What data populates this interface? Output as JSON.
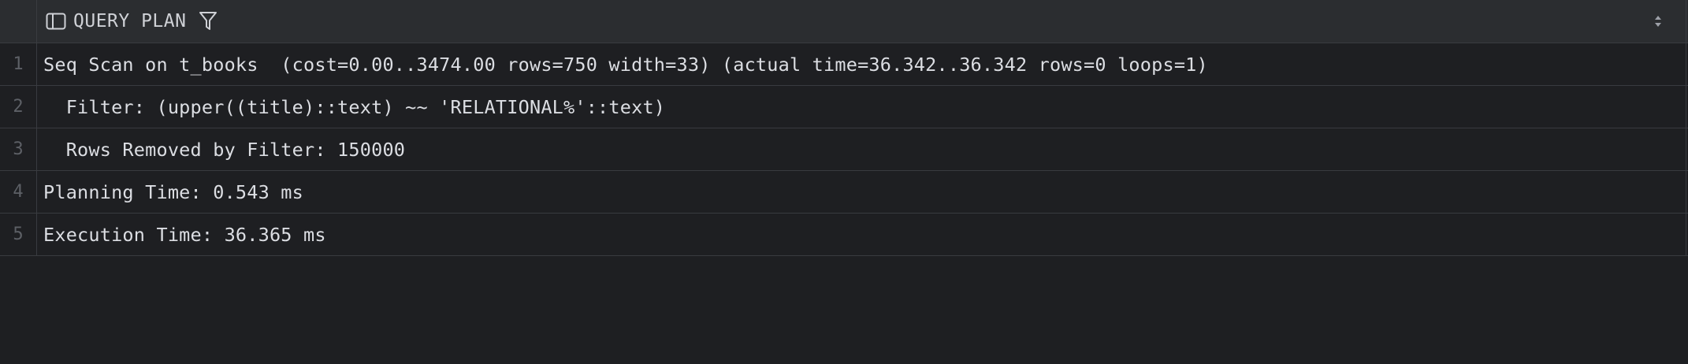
{
  "header": {
    "column_title": "QUERY PLAN",
    "column_icon": "table-column-icon",
    "filter_icon": "filter-icon",
    "sort_icon": "sort-updown-icon"
  },
  "rows": [
    {
      "num": "1",
      "text": "Seq Scan on t_books  (cost=0.00..3474.00 rows=750 width=33) (actual time=36.342..36.342 rows=0 loops=1)"
    },
    {
      "num": "2",
      "text": "  Filter: (upper((title)::text) ~~ 'RELATIONAL%'::text)"
    },
    {
      "num": "3",
      "text": "  Rows Removed by Filter: 150000"
    },
    {
      "num": "4",
      "text": "Planning Time: 0.543 ms"
    },
    {
      "num": "5",
      "text": "Execution Time: 36.365 ms"
    }
  ],
  "colors": {
    "background": "#1e1f22",
    "header_background": "#2b2d30",
    "grid_line": "#393b40",
    "text": "#dcdee3",
    "row_number": "#5d6066"
  }
}
